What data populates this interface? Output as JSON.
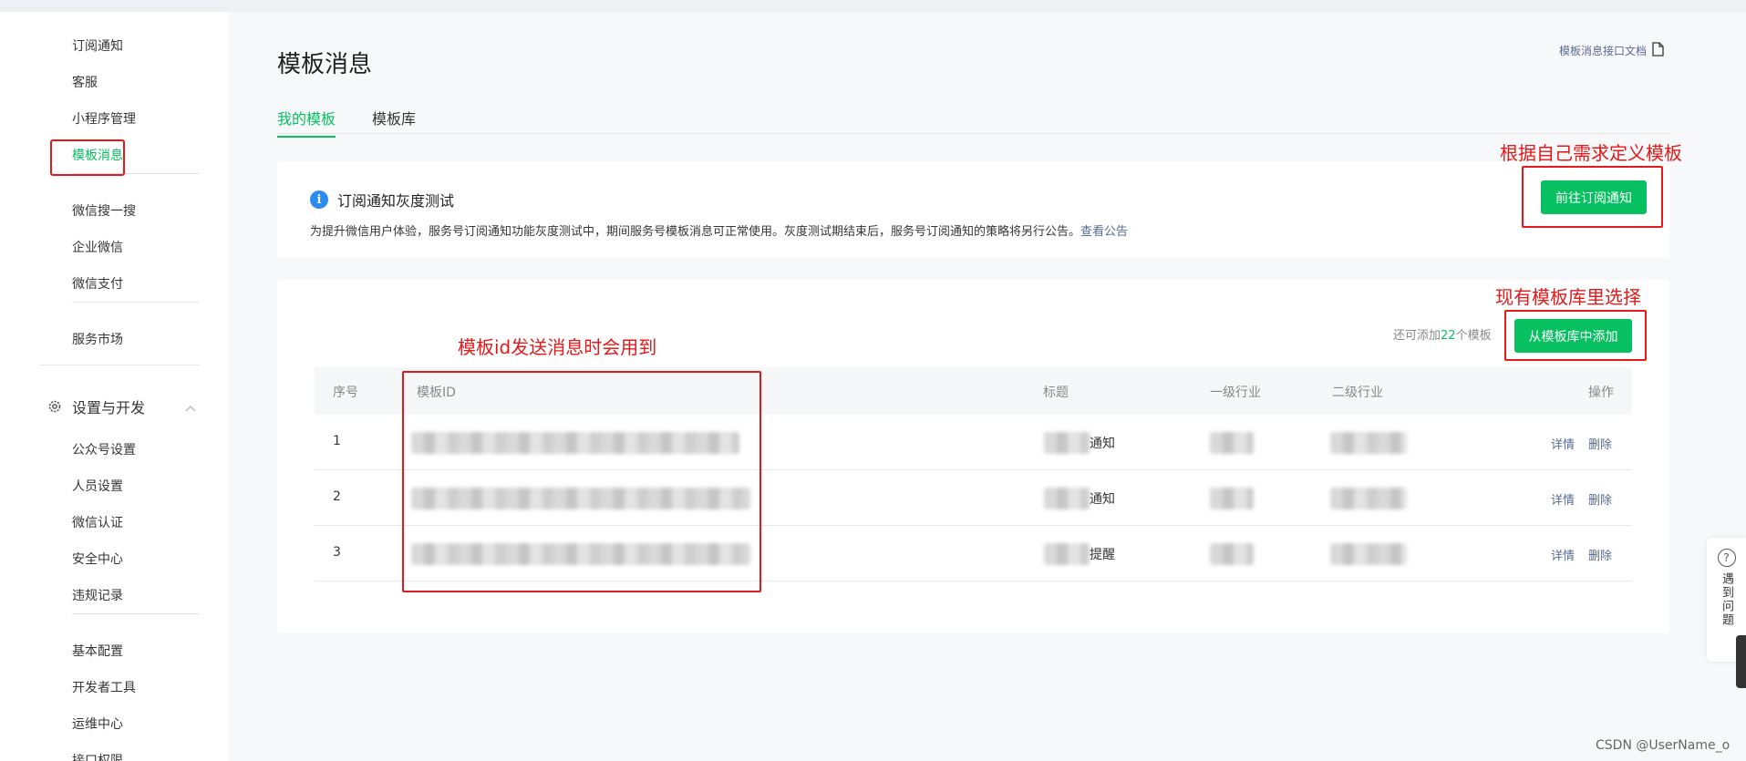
{
  "sidebar": {
    "items_top": [
      "订阅通知",
      "客服",
      "小程序管理",
      "模板消息"
    ],
    "items_mid": [
      "微信搜一搜",
      "企业微信",
      "微信支付"
    ],
    "items_market": [
      "服务市场"
    ],
    "group_label": "设置与开发",
    "group_items": [
      "公众号设置",
      "人员设置",
      "微信认证",
      "安全中心",
      "违规记录"
    ],
    "items_bottom": [
      "基本配置",
      "开发者工具",
      "运维中心",
      "接口权限"
    ]
  },
  "header": {
    "title": "模板消息",
    "doc_link": "模板消息接口文档"
  },
  "tabs": [
    "我的模板",
    "模板库"
  ],
  "notice": {
    "title": "订阅通知灰度测试",
    "desc": "为提升微信用户体验，服务号订阅通知功能灰度测试中，期间服务号模板消息可正常使用。灰度测试期结束后，服务号订阅通知的策略将另行公告。",
    "link": "查看公告",
    "button": "前往订阅通知"
  },
  "templates": {
    "quota_prefix": "还可添加",
    "quota_num": "22",
    "quota_suffix": "个模板",
    "add_button": "从模板库中添加",
    "columns": [
      "序号",
      "模板ID",
      "标题",
      "一级行业",
      "二级行业",
      "操作"
    ],
    "rows": [
      {
        "index": "1",
        "title_suffix": "通知"
      },
      {
        "index": "2",
        "title_suffix": "通知"
      },
      {
        "index": "3",
        "title_suffix": "提醒"
      }
    ],
    "action_detail": "详情",
    "action_delete": "删除"
  },
  "annotations": {
    "define": "根据自己需求定义模板",
    "choose": "现有模板库里选择",
    "id_note": "模板id发送消息时会用到"
  },
  "help": {
    "label": "遇到问题"
  },
  "watermark": "CSDN @UserName_o",
  "colors": {
    "brand_green": "#07c160",
    "link_blue": "#576b95",
    "annotation_red": "#e5191a",
    "info_blue": "#2a8bf2"
  }
}
